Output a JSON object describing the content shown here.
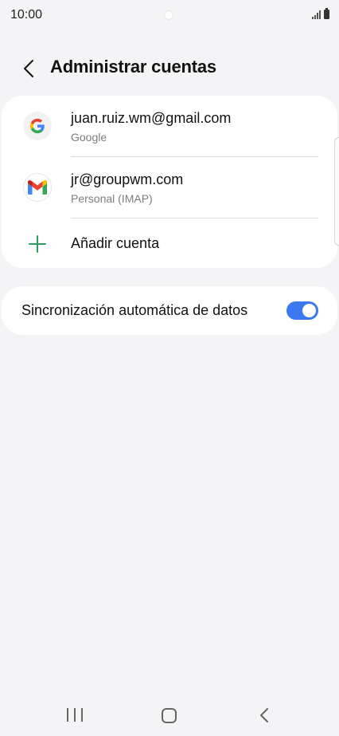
{
  "status_bar": {
    "time": "10:00",
    "icons": [
      "camera-dot",
      "signal-icon",
      "battery-icon"
    ]
  },
  "header": {
    "back_icon": "chevron-left-icon",
    "title": "Administrar cuentas"
  },
  "accounts": [
    {
      "email": "juan.ruiz.wm@gmail.com",
      "type": "Google",
      "icon": "google-icon"
    },
    {
      "email": "jr@groupwm.com",
      "type": "Personal (IMAP)",
      "icon": "gmail-icon"
    }
  ],
  "add_account": {
    "label": "Añadir cuenta",
    "icon": "plus-icon",
    "icon_color": "#2a9d5c"
  },
  "sync": {
    "label": "Sincronización automática de datos",
    "enabled": true,
    "toggle_color": "#3c78f0"
  },
  "nav_bar": {
    "icons": [
      "recents-icon",
      "home-icon",
      "back-icon"
    ]
  }
}
